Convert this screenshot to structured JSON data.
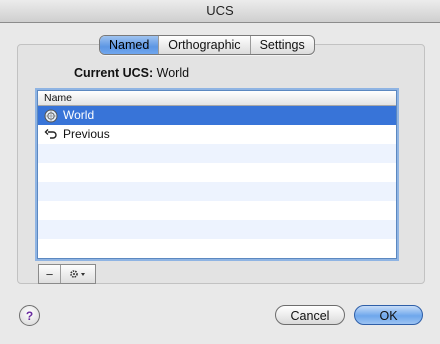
{
  "window": {
    "title": "UCS"
  },
  "tabs": [
    {
      "label": "Named",
      "selected": true
    },
    {
      "label": "Orthographic",
      "selected": false
    },
    {
      "label": "Settings",
      "selected": false
    }
  ],
  "current": {
    "label": "Current UCS:",
    "value": "World"
  },
  "table": {
    "header": "Name",
    "rows": [
      {
        "label": "World",
        "icon": "world-ucs-icon",
        "selected": true
      },
      {
        "label": "Previous",
        "icon": "undo-arrow-icon",
        "selected": false
      }
    ]
  },
  "toolbar": {
    "remove_label": "−",
    "options_icon": "gear-icon"
  },
  "buttons": {
    "help_label": "?",
    "cancel_label": "Cancel",
    "ok_label": "OK"
  },
  "colors": {
    "selection": "#3874d8",
    "accent": "#6ea7ec"
  }
}
